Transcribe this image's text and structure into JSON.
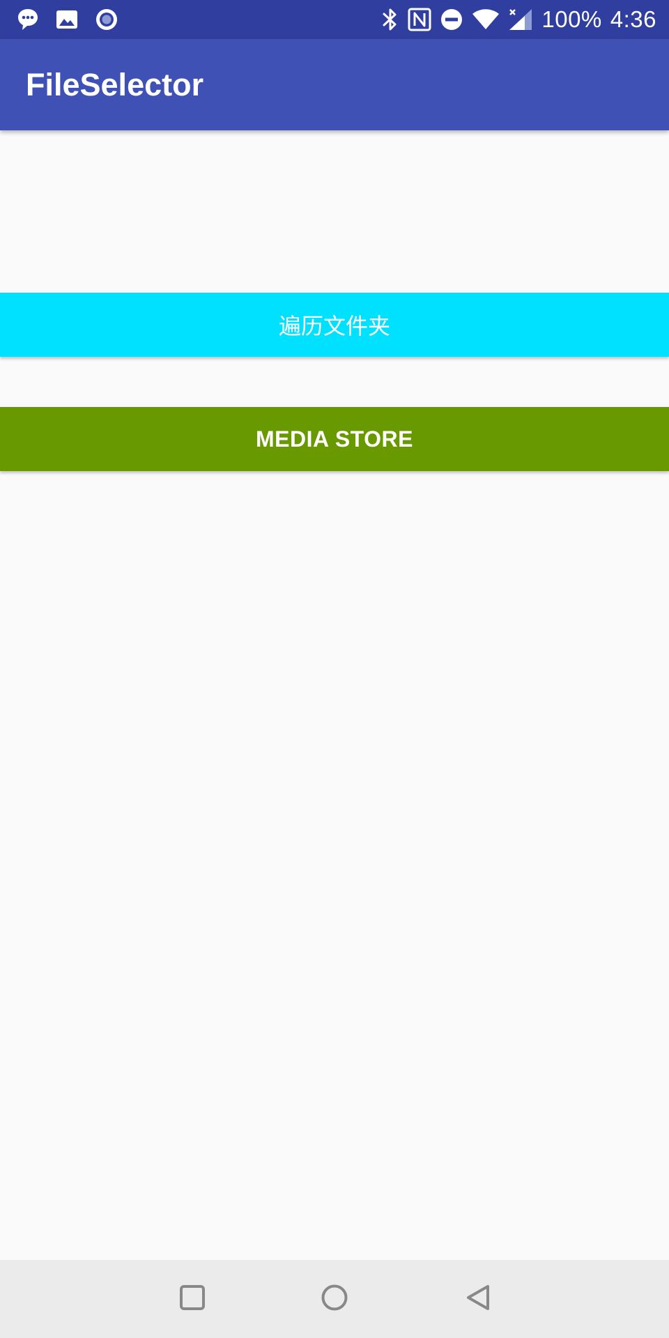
{
  "status_bar": {
    "background": "#303f9f",
    "left_icons": [
      "message-icon",
      "image-icon",
      "record-icon"
    ],
    "right_icons": [
      "bluetooth-icon",
      "nfc-icon",
      "do-not-disturb-icon",
      "wifi-icon",
      "cell-signal-icon"
    ],
    "battery": "100%",
    "time": "4:36"
  },
  "app_bar": {
    "title": "FileSelector",
    "background": "#3f51b5"
  },
  "buttons": {
    "traverse_folder": {
      "label": "遍历文件夹",
      "background": "#00e0ff"
    },
    "media_store": {
      "label": "MEDIA STORE",
      "background": "#689a00"
    }
  },
  "nav_bar": {
    "buttons": [
      "recents-icon",
      "home-icon",
      "back-icon"
    ],
    "background": "#ebebeb"
  }
}
